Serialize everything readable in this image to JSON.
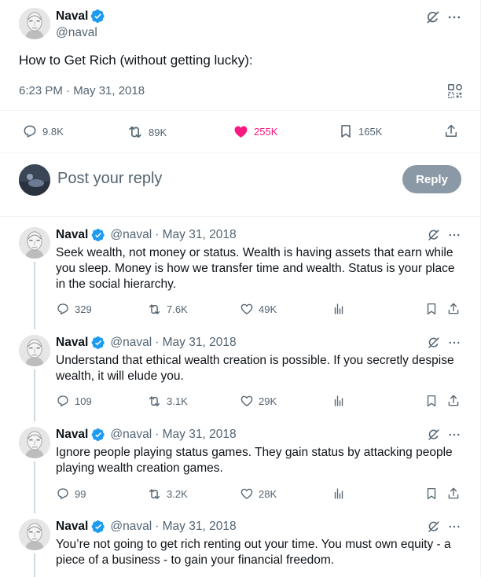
{
  "main_post": {
    "name": "Naval",
    "handle": "@naval",
    "text": "How to Get Rich (without getting lucky):",
    "timestamp": "6:23 PM · May 31, 2018",
    "replies": "9.8K",
    "reposts": "89K",
    "likes": "255K",
    "bookmarks": "165K",
    "like_color": "#f91880"
  },
  "composer": {
    "placeholder": "Post your reply",
    "button_label": "Reply"
  },
  "replies": [
    {
      "name": "Naval",
      "handle": "@naval",
      "date": "· May 31, 2018",
      "text": "Seek wealth, not money or status. Wealth is having assets that earn while you sleep. Money is how we transfer time and wealth. Status is your place in the social hierarchy.",
      "replies": "329",
      "reposts": "7.6K",
      "likes": "49K"
    },
    {
      "name": "Naval",
      "handle": "@naval",
      "date": "· May 31, 2018",
      "text": "Understand that ethical wealth creation is possible. If you secretly despise wealth, it will elude you.",
      "replies": "109",
      "reposts": "3.1K",
      "likes": "29K"
    },
    {
      "name": "Naval",
      "handle": "@naval",
      "date": "· May 31, 2018",
      "text": "Ignore people playing status games. They gain status by attacking people playing wealth creation games.",
      "replies": "99",
      "reposts": "3.2K",
      "likes": "28K"
    },
    {
      "name": "Naval",
      "handle": "@naval",
      "date": "· May 31, 2018",
      "text": "You’re not going to get rich renting out your time. You must own equity - a piece of a business - to gain your financial freedom."
    }
  ],
  "colors": {
    "verified": "#1d9bf0",
    "text_secondary": "#536471",
    "like_active": "#f91880",
    "reply_button": "#8b98a5"
  }
}
